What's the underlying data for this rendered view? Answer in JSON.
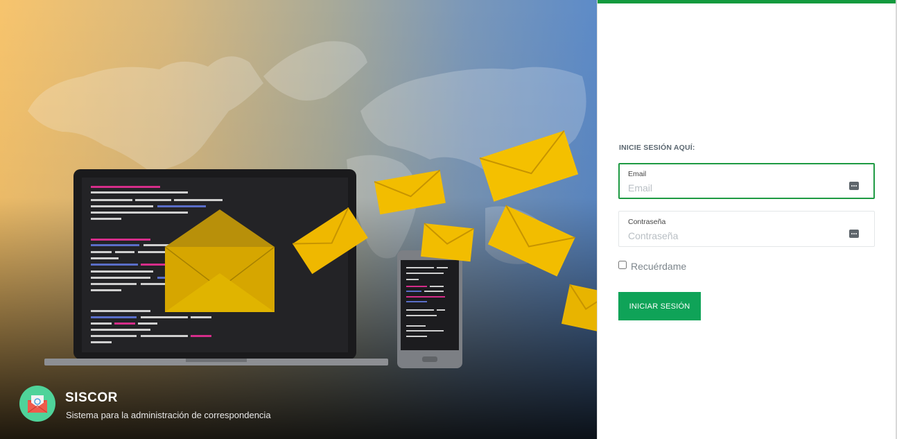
{
  "brand": {
    "title": "SISCOR",
    "subtitle": "Sistema para la administración de correspondencia",
    "logo_icon": "envelope-icon"
  },
  "login": {
    "heading": "INICIE SESIÓN AQUÍ:",
    "email": {
      "label": "Email",
      "placeholder": "Email",
      "value": "",
      "icon": "password-dots-icon"
    },
    "password": {
      "label": "Contraseña",
      "placeholder": "Contraseña",
      "value": "",
      "icon": "password-dots-icon"
    },
    "remember_label": "Recuérdame",
    "remember_checked": false,
    "submit_label": "INICIAR SESIÓN"
  },
  "colors": {
    "accent_green": "#139a3e",
    "button_green": "#0fa358",
    "envelope_yellow": "#f0bb00",
    "logo_green": "#4fd39a"
  }
}
